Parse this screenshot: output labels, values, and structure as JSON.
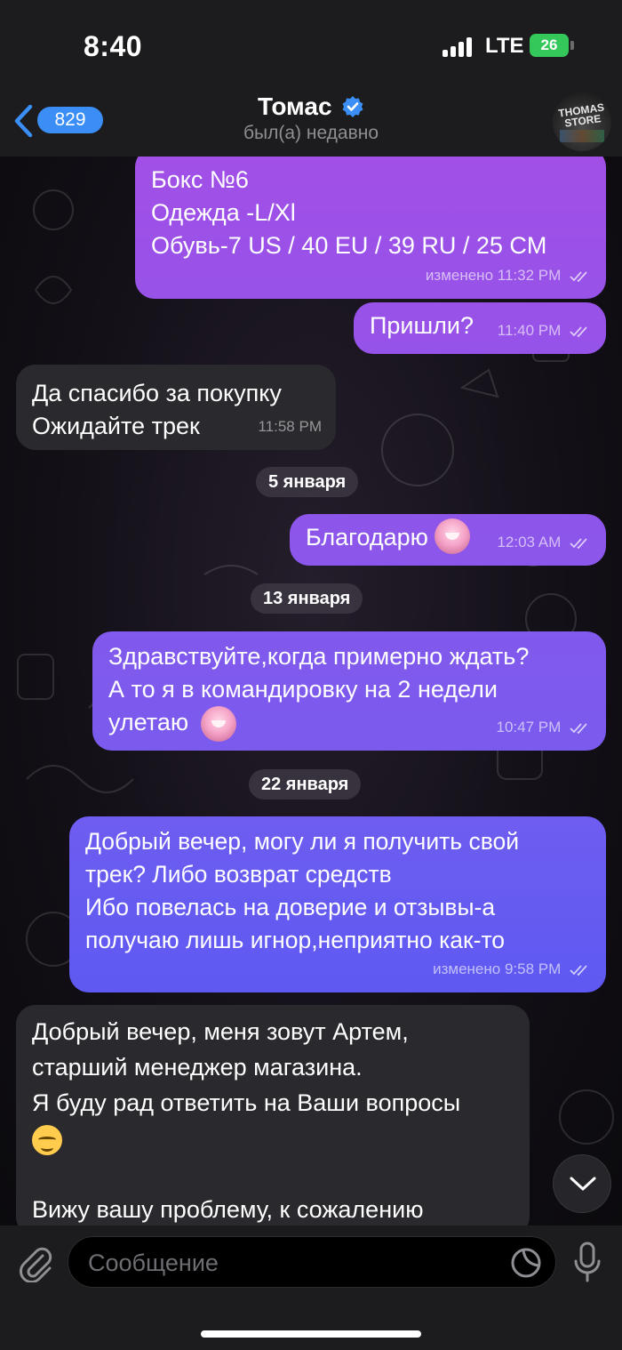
{
  "status_bar": {
    "time": "8:40",
    "network": "LTE",
    "battery": "26"
  },
  "header": {
    "back_count": "829",
    "contact_name": "Томас",
    "contact_status": "был(а) недавно",
    "avatar_text": "THOMAS STORE"
  },
  "messages": {
    "m1": {
      "lines": [
        "Бокс №6",
        "Одежда -L/Xl",
        "Обувь-7 US / 40 EU / 39 RU / 25 CM"
      ],
      "meta": "изменено 11:32 PM"
    },
    "m2": {
      "text": "Пришли?",
      "meta": "11:40 PM"
    },
    "m3": {
      "lines": [
        "Да спасибо за покупку",
        "Ожидайте трек"
      ],
      "meta": "11:58 PM"
    },
    "m4": {
      "text": "Благодарю",
      "meta": "12:03 AM"
    },
    "m5": {
      "lines": [
        "Здравствуйте,когда примерно ждать?",
        "А то я в командировку на 2 недели",
        "улетаю"
      ],
      "meta": "10:47 PM"
    },
    "m6": {
      "lines": [
        "Добрый вечер, могу ли я получить свой",
        "трек? Либо возврат средств",
        "Ибо повелась на доверие и отзывы-а",
        "получаю лишь игнор,неприятно как-то"
      ],
      "meta": "изменено 9:58 PM"
    },
    "m7": {
      "lines": [
        "Добрый вечер, меня зовут Артем,",
        "старший менеджер магазина.",
        "Я буду рад ответить на Ваши вопросы",
        "",
        "Вижу вашу проблему, к сожалению"
      ]
    }
  },
  "dates": {
    "d1": "5 января",
    "d2": "13 января",
    "d3": "22 января"
  },
  "composer": {
    "placeholder": "Сообщение"
  },
  "colors": {
    "outgoing_top": "#9b4fe0",
    "outgoing_bottom": "#5b57f0",
    "incoming": "#2a2a2e",
    "accent": "#3a8ef6"
  }
}
